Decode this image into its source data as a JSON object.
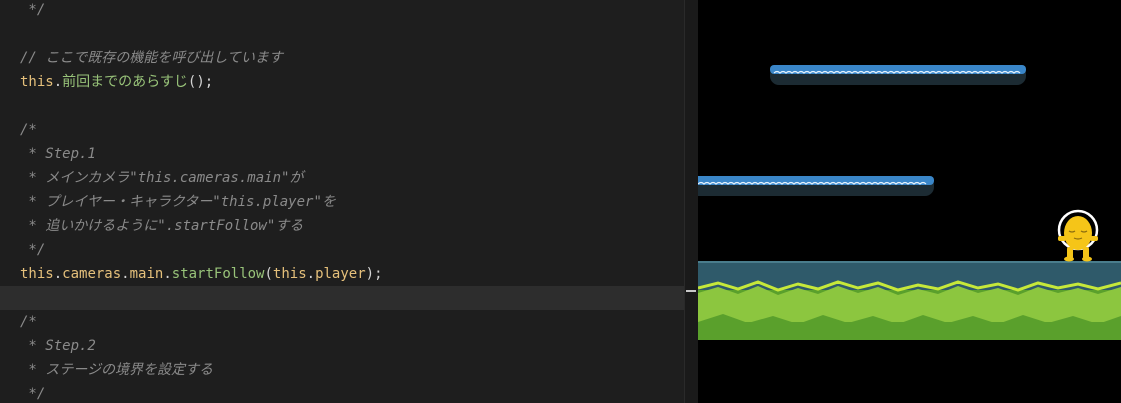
{
  "editor": {
    "lines": {
      "l0": " */",
      "l1": "// ここで既存の機能を呼び出しています",
      "l2_kw": "this",
      "l2_dot": ".",
      "l2_method": "前回までのあらすじ",
      "l2_rest": "();",
      "l3": "/*",
      "l4": " * Step.1",
      "l5": " * メインカメラ\"this.cameras.main\"が",
      "l6": " * プレイヤー・キャラクター\"this.player\"を",
      "l7": " * 追いかけるように\".startFollow\"する",
      "l8": " */",
      "l9_kw1": "this",
      "l9_dot1": ".",
      "l9_cameras": "cameras",
      "l9_dot2": ".",
      "l9_main": "main",
      "l9_dot3": ".",
      "l9_method": "startFollow",
      "l9_paren": "(",
      "l9_kw2": "this",
      "l9_dot4": ".",
      "l9_player": "player",
      "l9_end": ");",
      "l10": "/*",
      "l11": " * Step.2",
      "l12": " * ステージの境界を設定する",
      "l13": " */"
    }
  },
  "colors": {
    "editor_bg": "#1e1e1e",
    "comment": "#8a8a8a",
    "keyword": "#e5c07b",
    "method": "#98c379",
    "platform_top": "#3a86c8",
    "ground_water": "#2f5a6a",
    "grass_light": "#8cc63f",
    "grass_dark": "#5aa02c",
    "player": "#f5c518"
  },
  "game": {
    "player_icon": "yellow-player-character-icon"
  }
}
